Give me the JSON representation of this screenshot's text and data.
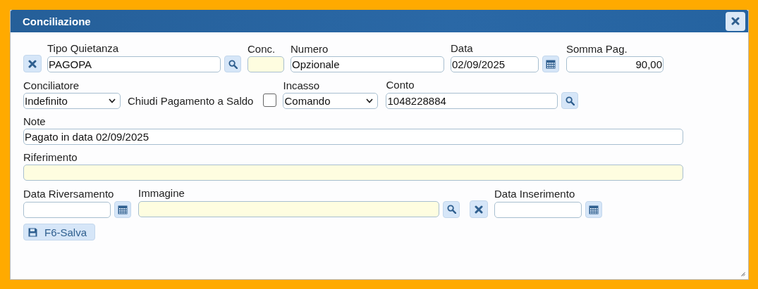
{
  "window": {
    "title": "Conciliazione"
  },
  "tipo_quietanza": {
    "label": "Tipo Quietanza",
    "value": "PAGOPA",
    "highlighted": false
  },
  "conc": {
    "label": "Conc.",
    "highlighted": true
  },
  "numero": {
    "label": "Numero",
    "value": "Opzionale",
    "highlighted": false
  },
  "data": {
    "label": "Data",
    "value": "02/09/2025",
    "highlighted": false
  },
  "somma_pag": {
    "label": "Somma Pag.",
    "value": "90,00",
    "highlighted": false
  },
  "conciliatore": {
    "label": "Conciliatore",
    "value": "Indefinito"
  },
  "chiudi_pagamento": {
    "label": "Chiudi Pagamento a Saldo",
    "checked": false
  },
  "incasso": {
    "label": "Incasso",
    "value": "Comando"
  },
  "conto": {
    "label": "Conto",
    "value": "1048228884",
    "highlighted": false
  },
  "note": {
    "label": "Note",
    "value": "Pagato in data 02/09/2025",
    "highlighted": false
  },
  "riferimento": {
    "label": "Riferimento",
    "highlighted": true
  },
  "data_riversamento": {
    "label": "Data Riversamento",
    "highlighted": false
  },
  "immagine": {
    "label": "Immagine",
    "highlighted": true
  },
  "data_inserimento": {
    "label": "Data Inserimento",
    "highlighted": false
  },
  "save_button": {
    "label": "F6-Salva"
  }
}
